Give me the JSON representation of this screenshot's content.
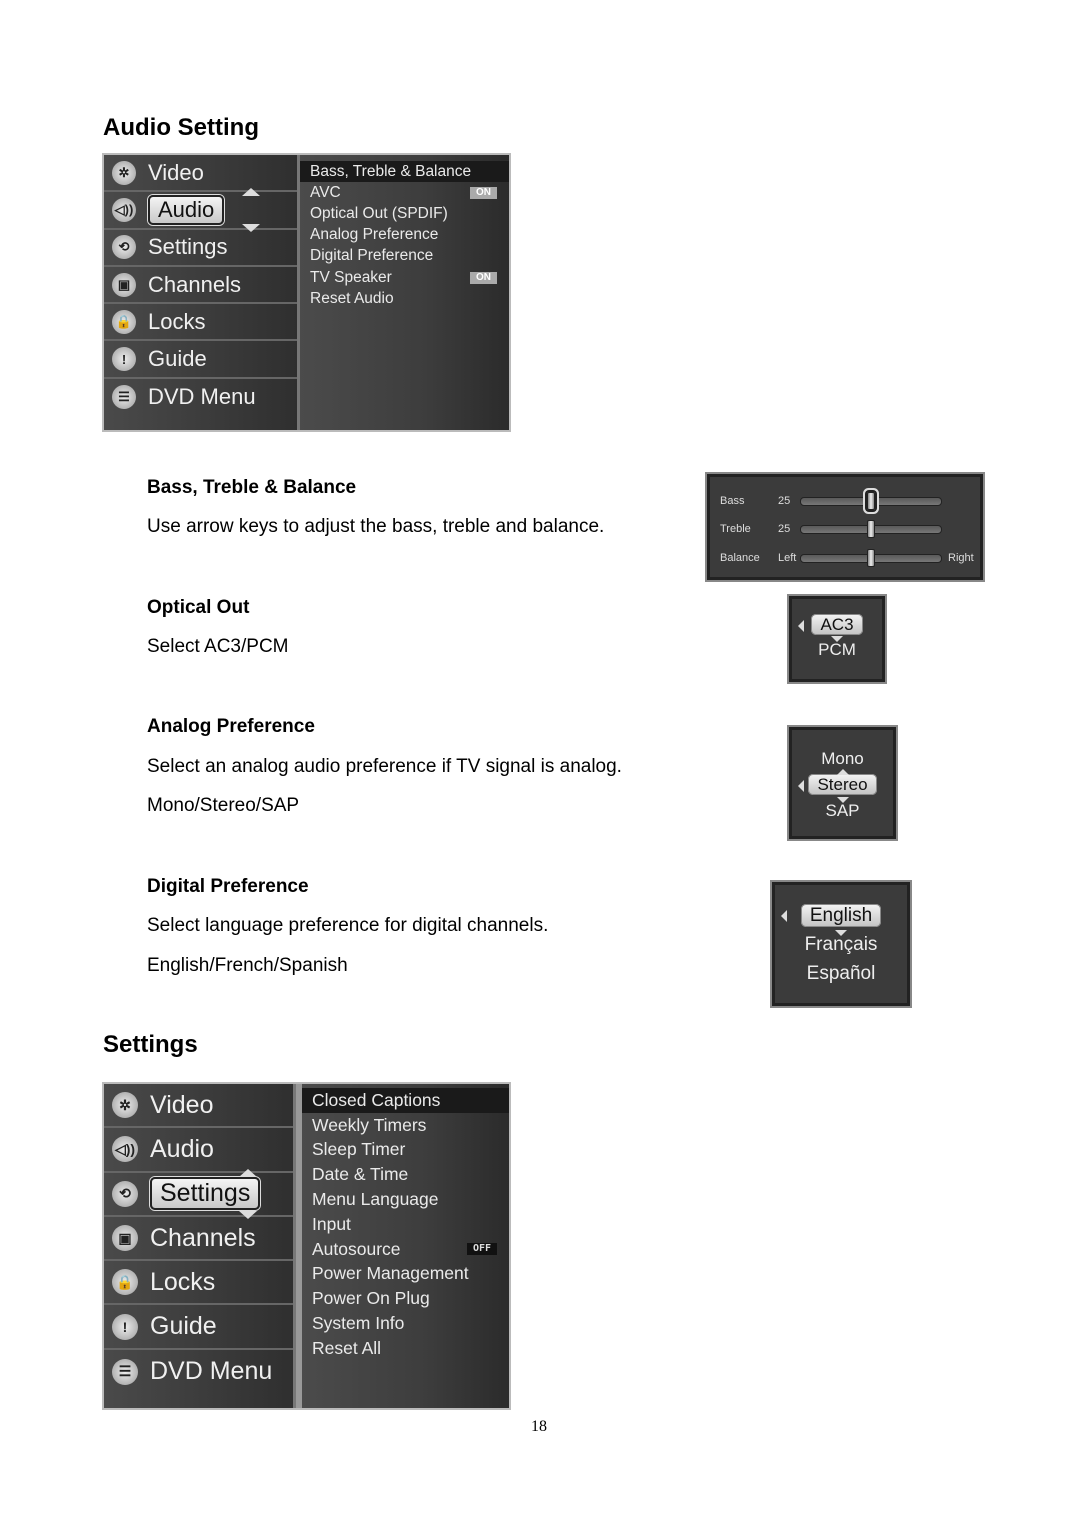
{
  "sections": {
    "audio": {
      "title": "Audio Setting",
      "menu": {
        "left_items": [
          {
            "label": "Video",
            "icon": "gear-icon",
            "glyph": "✲"
          },
          {
            "label": "Audio",
            "icon": "speaker-icon",
            "glyph": "◁))",
            "selected": true
          },
          {
            "label": "Settings",
            "icon": "settings-cycle-icon",
            "glyph": "⟲"
          },
          {
            "label": "Channels",
            "icon": "tv-icon",
            "glyph": "▣"
          },
          {
            "label": "Locks",
            "icon": "lock-icon",
            "glyph": "🔒"
          },
          {
            "label": "Guide",
            "icon": "exclamation-icon",
            "glyph": "!"
          },
          {
            "label": "DVD Menu",
            "icon": "sliders-icon",
            "glyph": "☰"
          }
        ],
        "right_items": [
          {
            "label": "Bass, Treble & Balance",
            "highlighted": true,
            "badge": ""
          },
          {
            "label": "AVC",
            "badge": "ON"
          },
          {
            "label": "Optical Out (SPDIF)",
            "badge": ""
          },
          {
            "label": "Analog Preference",
            "badge": ""
          },
          {
            "label": "Digital Preference",
            "badge": ""
          },
          {
            "label": "TV Speaker",
            "badge": "ON"
          },
          {
            "label": "Reset Audio",
            "badge": ""
          }
        ]
      },
      "subsections": [
        {
          "heading": "Bass, Treble & Balance",
          "lines": [
            "Use arrow keys to adjust the bass, treble and balance."
          ]
        },
        {
          "heading": "Optical Out",
          "lines": [
            "Select AC3/PCM"
          ]
        },
        {
          "heading": "Analog Preference",
          "lines": [
            "Select an analog audio preference if TV signal is analog.",
            "Mono/Stereo/SAP"
          ]
        },
        {
          "heading": "Digital Preference",
          "lines": [
            "Select language preference for digital channels.",
            "English/French/Spanish"
          ]
        }
      ],
      "sliders": {
        "bass": {
          "label": "Bass",
          "value": "25",
          "position": 0.5
        },
        "treble": {
          "label": "Treble",
          "value": "25",
          "position": 0.5
        },
        "balance": {
          "label": "Balance",
          "left": "Left",
          "right": "Right",
          "position": 0.5
        }
      },
      "optical_options": [
        "AC3",
        "PCM"
      ],
      "optical_selected": "AC3",
      "analog_options": [
        "Mono",
        "Stereo",
        "SAP"
      ],
      "analog_selected": "Stereo",
      "digital_options": [
        "English",
        "Français",
        "Español"
      ],
      "digital_selected": "English"
    },
    "settings": {
      "title": "Settings",
      "menu": {
        "left_items": [
          {
            "label": "Video",
            "icon": "gear-icon",
            "glyph": "✲"
          },
          {
            "label": "Audio",
            "icon": "speaker-icon",
            "glyph": "◁))"
          },
          {
            "label": "Settings",
            "icon": "settings-cycle-icon",
            "glyph": "⟲",
            "selected": true
          },
          {
            "label": "Channels",
            "icon": "tv-icon",
            "glyph": "▣"
          },
          {
            "label": "Locks",
            "icon": "lock-icon",
            "glyph": "🔒"
          },
          {
            "label": "Guide",
            "icon": "exclamation-icon",
            "glyph": "!"
          },
          {
            "label": "DVD Menu",
            "icon": "sliders-icon",
            "glyph": "☰"
          }
        ],
        "right_items": [
          {
            "label": "Closed Captions",
            "highlighted": true,
            "badge": ""
          },
          {
            "label": "Weekly Timers",
            "badge": ""
          },
          {
            "label": "Sleep Timer",
            "badge": ""
          },
          {
            "label": "Date & Time",
            "badge": ""
          },
          {
            "label": "Menu Language",
            "badge": ""
          },
          {
            "label": "Input",
            "badge": ""
          },
          {
            "label": "Autosource",
            "badge": "OFF"
          },
          {
            "label": "Power Management",
            "badge": ""
          },
          {
            "label": "Power On Plug",
            "badge": ""
          },
          {
            "label": "System Info",
            "badge": ""
          },
          {
            "label": "Reset All",
            "badge": ""
          }
        ]
      }
    }
  },
  "page_number": "18"
}
